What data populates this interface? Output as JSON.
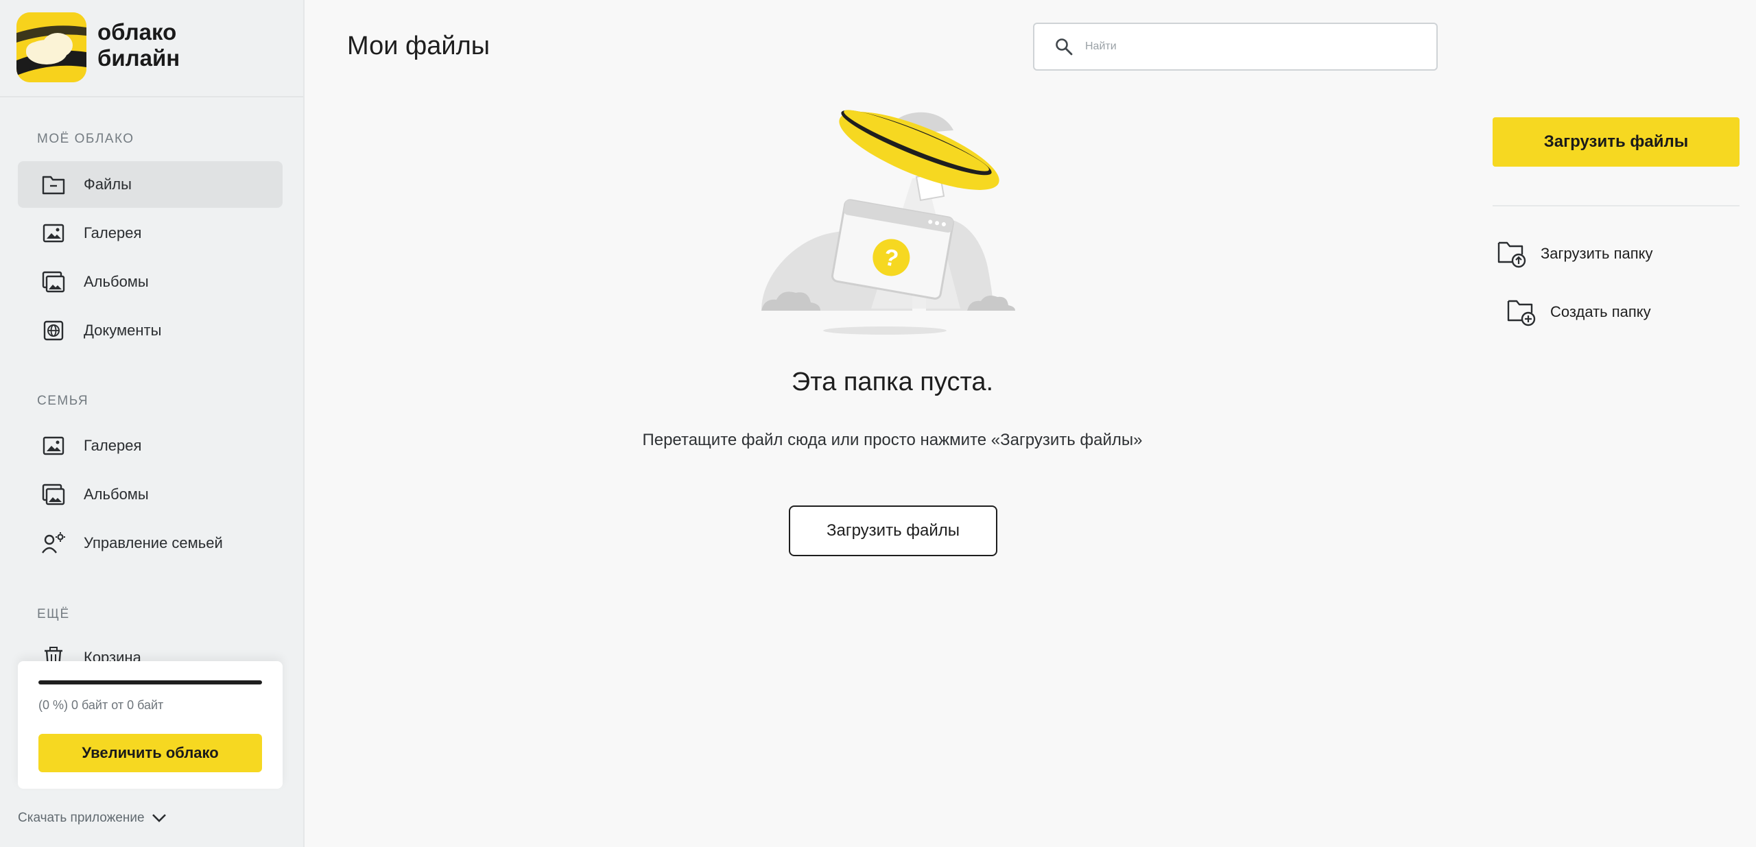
{
  "brand": {
    "name_line1": "облако",
    "name_line2": "билайн",
    "accent": "#f6d821"
  },
  "sidebar": {
    "sections": [
      {
        "title": "Моё облако",
        "items": [
          {
            "label": "Файлы",
            "icon": "folder-icon",
            "active": true
          },
          {
            "label": "Галерея",
            "icon": "image-icon"
          },
          {
            "label": "Альбомы",
            "icon": "album-icon"
          },
          {
            "label": "Документы",
            "icon": "document-globe-icon"
          }
        ]
      },
      {
        "title": "Семья",
        "items": [
          {
            "label": "Галерея",
            "icon": "image-icon"
          },
          {
            "label": "Альбомы",
            "icon": "album-icon"
          },
          {
            "label": "Управление семьей",
            "icon": "family-settings-icon"
          }
        ]
      },
      {
        "title": "Ещё",
        "items": [
          {
            "label": "Корзина",
            "icon": "trash-icon"
          }
        ]
      }
    ],
    "storage": {
      "used_fraction": 0,
      "text": "(0 %) 0 байт от 0 байт",
      "button_label": "Увеличить облако"
    },
    "download_app_label": "Скачать приложение"
  },
  "header": {
    "title": "Мои файлы",
    "search_placeholder": "Найти",
    "search_value": ""
  },
  "empty_state": {
    "title": "Эта папка пуста.",
    "subtitle": "Перетащите файл сюда или просто нажмите «Загрузить файлы»",
    "button_label": "Загрузить файлы"
  },
  "right_panel": {
    "upload_button_label": "Загрузить файлы",
    "actions": [
      {
        "label": "Загрузить папку",
        "icon": "folder-upload-icon"
      },
      {
        "label": "Создать папку",
        "icon": "folder-add-icon"
      }
    ]
  }
}
